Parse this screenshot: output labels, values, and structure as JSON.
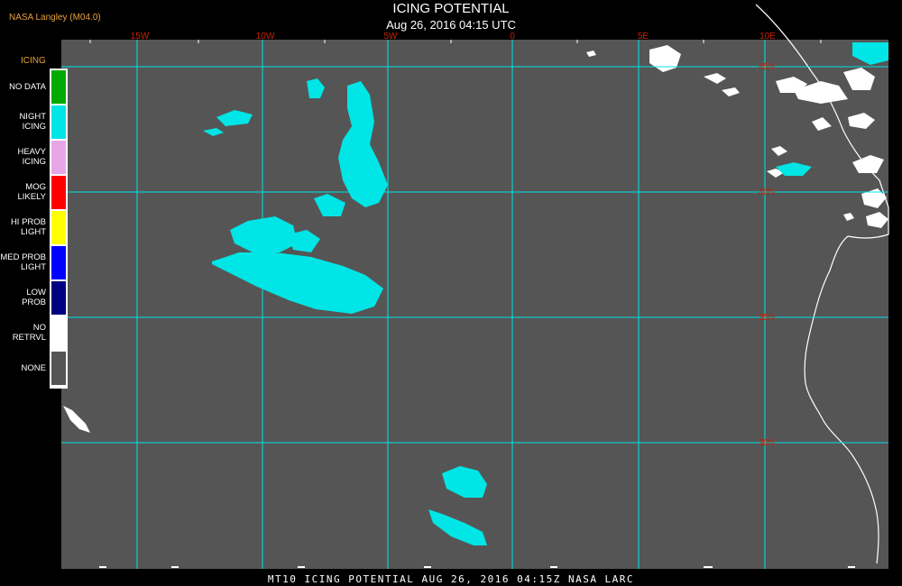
{
  "header": {
    "credit": "NASA Langley (M04.0)",
    "title": "ICING POTENTIAL",
    "subtitle": "Aug 26, 2016 04:15 UTC"
  },
  "colors": {
    "background": "#555555",
    "grid": "#00e5e5",
    "icing": "#00e5e5",
    "cloud": "#ffffff",
    "lat_label": "#cc2200",
    "lon_label": "#cc2200"
  },
  "longitude_labels": [
    "15W",
    "10W",
    "5W",
    "0",
    "5E",
    "10E"
  ],
  "latitude_labels": [
    "45N",
    "40N",
    "35N",
    "30N"
  ],
  "legend": {
    "title": "ICING",
    "items": [
      {
        "label": "NO DATA",
        "color": "#00aa00"
      },
      {
        "label": "NIGHT\nICING",
        "color": "#00e5e5"
      },
      {
        "label": "HEAVY\nICING",
        "color": "#e6a6e6"
      },
      {
        "label": "MOG\nLIKELY",
        "color": "#ff0000"
      },
      {
        "label": "HI PROB\nLIGHT",
        "color": "#ffff00"
      },
      {
        "label": "MED PROB\nLIGHT",
        "color": "#0000ff"
      },
      {
        "label": "LOW\nPROB",
        "color": "#000080"
      },
      {
        "label": "NO\nRETRVL",
        "color": "#ffffff"
      },
      {
        "label": "NONE",
        "color": "#555555"
      }
    ]
  },
  "footer": "MT10  ICING POTENTIAL   AUG 26, 2016 04:15Z   NASA LARC"
}
